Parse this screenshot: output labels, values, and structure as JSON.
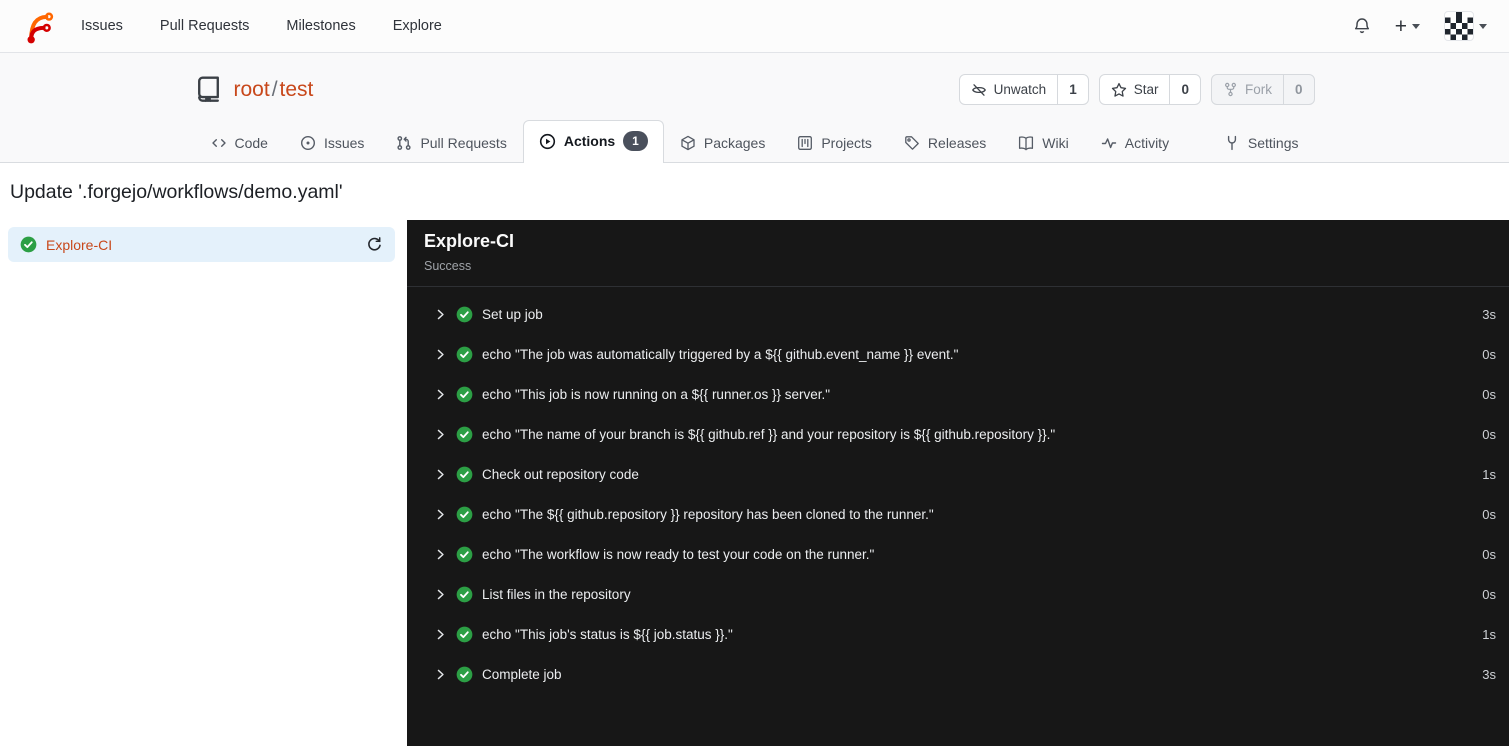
{
  "colors": {
    "accent": "#c8481b",
    "success_green": "#2c9f45",
    "panel_bg": "#171717",
    "job_selected_bg": "#e4f1fb",
    "badge_bg": "#4a505c"
  },
  "navbar": {
    "links": [
      "Issues",
      "Pull Requests",
      "Milestones",
      "Explore"
    ],
    "new_label": "+"
  },
  "repo": {
    "owner": "root",
    "separator": "/",
    "name": "test",
    "watch": {
      "label": "Unwatch",
      "count": "1"
    },
    "star": {
      "label": "Star",
      "count": "0"
    },
    "fork": {
      "label": "Fork",
      "count": "0"
    }
  },
  "tabs": [
    {
      "label": "Code"
    },
    {
      "label": "Issues"
    },
    {
      "label": "Pull Requests"
    },
    {
      "label": "Actions",
      "badge": "1"
    },
    {
      "label": "Packages"
    },
    {
      "label": "Projects"
    },
    {
      "label": "Releases"
    },
    {
      "label": "Wiki"
    },
    {
      "label": "Activity"
    },
    {
      "label": "Settings"
    }
  ],
  "page": {
    "title": "Update '.forgejo/workflows/demo.yaml'"
  },
  "sidebar": {
    "job_name": "Explore-CI"
  },
  "panel": {
    "title": "Explore-CI",
    "status": "Success",
    "steps": [
      {
        "name": "Set up job",
        "duration": "3s"
      },
      {
        "name": "echo \"The job was automatically triggered by a ${{ github.event_name }} event.\"",
        "duration": "0s"
      },
      {
        "name": "echo \"This job is now running on a ${{ runner.os }} server.\"",
        "duration": "0s"
      },
      {
        "name": "echo \"The name of your branch is ${{ github.ref }} and your repository is ${{ github.repository }}.\"",
        "duration": "0s"
      },
      {
        "name": "Check out repository code",
        "duration": "1s"
      },
      {
        "name": "echo \"The ${{ github.repository }} repository has been cloned to the runner.\"",
        "duration": "0s"
      },
      {
        "name": "echo \"The workflow is now ready to test your code on the runner.\"",
        "duration": "0s"
      },
      {
        "name": "List files in the repository",
        "duration": "0s"
      },
      {
        "name": "echo \"This job's status is ${{ job.status }}.\"",
        "duration": "1s"
      },
      {
        "name": "Complete job",
        "duration": "3s"
      }
    ]
  }
}
